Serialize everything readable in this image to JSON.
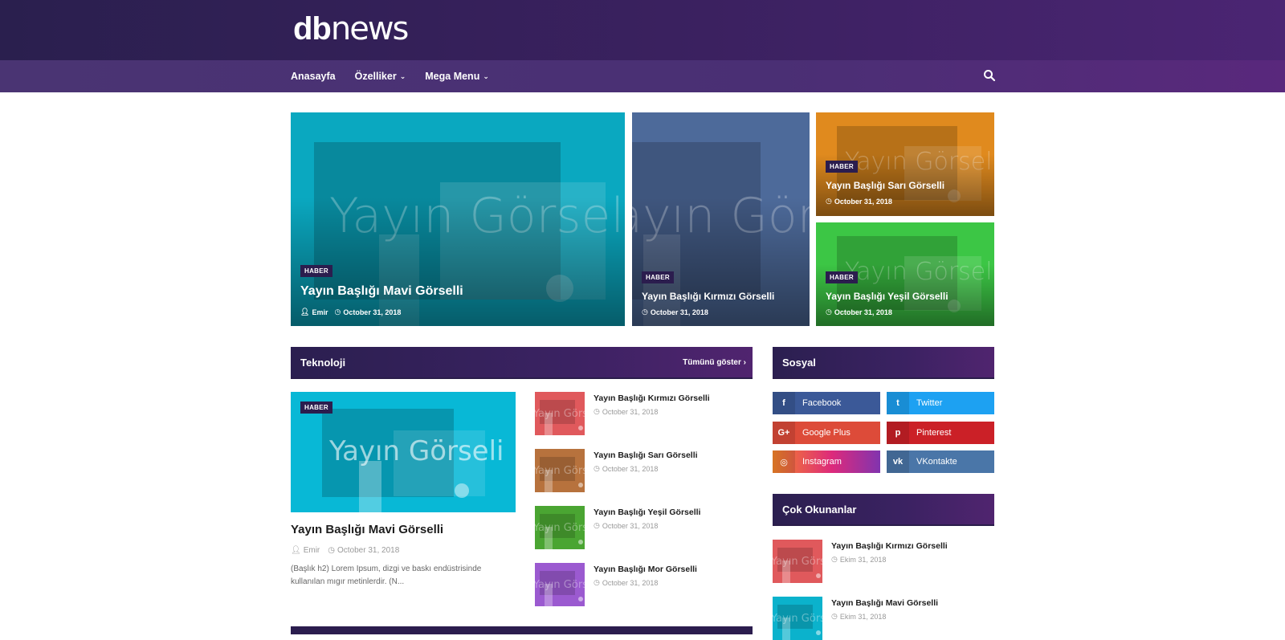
{
  "header": {
    "logo_bold": "db",
    "logo_light": "news"
  },
  "nav": {
    "items": [
      {
        "label": "Anasayfa",
        "dropdown": false
      },
      {
        "label": "Özelliker",
        "dropdown": true
      },
      {
        "label": "Mega Menu",
        "dropdown": true
      }
    ]
  },
  "placeholder_text": "Yayın Görseli",
  "hero": {
    "main": {
      "badge": "HABER",
      "title": "Yayın Başlığı Mavi Görselli",
      "author": "Emir",
      "date": "October 31, 2018",
      "color": "#0aa8c0"
    },
    "second": {
      "badge": "HABER",
      "title": "Yayın Başlığı Kırmızı Görselli",
      "date": "October 31, 2018",
      "color": "#4d6a9a"
    },
    "third": {
      "badge": "HABER",
      "title": "Yayın Başlığı Sarı Görselli",
      "date": "October 31, 2018",
      "color": "#e08a1e"
    },
    "fourth": {
      "badge": "HABER",
      "title": "Yayın Başlığı Yeşil Görselli",
      "date": "October 31, 2018",
      "color": "#3cc645"
    }
  },
  "tech": {
    "heading": "Teknoloji",
    "more": "Tümünü göster",
    "featured": {
      "badge": "HABER",
      "title": "Yayın Başlığı Mavi Görselli",
      "author": "Emir",
      "date": "October 31, 2018",
      "excerpt": "(Başlık h2) Lorem Ipsum, dizgi ve baskı endüstrisinde kullanılan mıgır metinlerdir. (N..."
    },
    "list": [
      {
        "title": "Yayın Başlığı Kırmızı Görselli",
        "date": "October 31, 2018",
        "color": "#e0595c"
      },
      {
        "title": "Yayın Başlığı Sarı Görselli",
        "date": "October 31, 2018",
        "color": "#b7723d"
      },
      {
        "title": "Yayın Başlığı Yeşil Görselli",
        "date": "October 31, 2018",
        "color": "#4aa532"
      },
      {
        "title": "Yayın Başlığı Mor Görselli",
        "date": "October 31, 2018",
        "color": "#9b5ad0"
      }
    ]
  },
  "social": {
    "heading": "Sosyal",
    "items": [
      {
        "label": "Facebook",
        "glyph": "f",
        "color": "#3b5998"
      },
      {
        "label": "Twitter",
        "glyph": "t",
        "color": "#1da1f2"
      },
      {
        "label": "Google Plus",
        "glyph": "G+",
        "color": "#dd4b39"
      },
      {
        "label": "Pinterest",
        "glyph": "p",
        "color": "#cb2027"
      },
      {
        "label": "Instagram",
        "glyph": "◎",
        "color": "#e1306c"
      },
      {
        "label": "VKontakte",
        "glyph": "vk",
        "color": "#4a76a8"
      }
    ]
  },
  "popular": {
    "heading": "Çok Okunanlar",
    "items": [
      {
        "title": "Yayın Başlığı Kırmızı Görselli",
        "date": "Ekim 31, 2018",
        "color": "#e0595c"
      },
      {
        "title": "Yayın Başlığı Mavi Görselli",
        "date": "Ekim 31, 2018",
        "color": "#0bb2cc"
      }
    ]
  }
}
